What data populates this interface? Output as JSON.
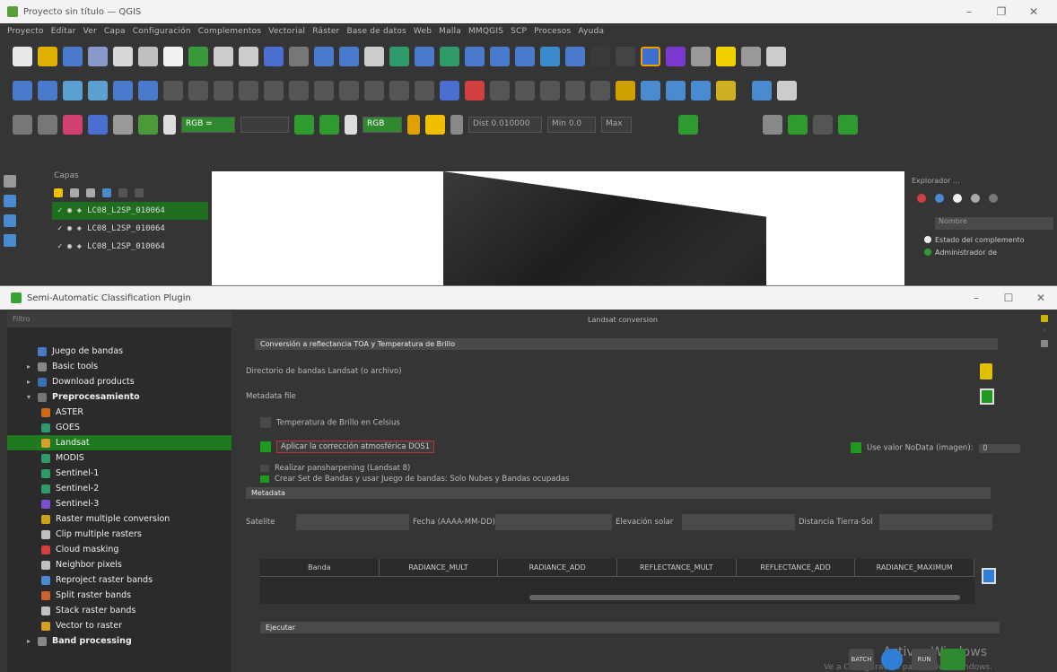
{
  "qgis": {
    "title": "Proyecto sin título — QGIS",
    "menu": [
      "Proyecto",
      "Editar",
      "Ver",
      "Capa",
      "Configuración",
      "Complementos",
      "Vectorial",
      "Ráster",
      "Base de datos",
      "Web",
      "Malla",
      "MMQGIS",
      "SCP",
      "Procesos",
      "Ayuda"
    ],
    "toolbar3": {
      "rgb_label": "RGB =",
      "rgb2_label": "RGB",
      "dist_label": "Dist 0.010000",
      "min_label": "Min 0.0",
      "max_label": "Max"
    },
    "layers_title": "Capas",
    "layers": [
      "LC08_L2SP_010064",
      "LC08_L2SP_010064",
      "LC08_L2SP_010064"
    ],
    "browser_title": "Explorador ... ",
    "browser_bar": "Nombre",
    "browser_rows": [
      "Estado del complemento",
      "Administrador de"
    ]
  },
  "scp": {
    "title": "Semi-Automatic Classification Plugin",
    "search_placeholder": "Filtro",
    "menu": [
      {
        "label": "Juego de bandas",
        "level": 1,
        "icon": "band-set-icon",
        "color": "#4a7acc"
      },
      {
        "label": "Basic tools",
        "level": 1,
        "icon": "tools-icon",
        "color": "#888888",
        "arrow": "▸"
      },
      {
        "label": "Download products",
        "level": 1,
        "icon": "download-icon",
        "color": "#3a6fb0",
        "arrow": "▸"
      },
      {
        "label": "Preprocesamiento",
        "level": 1,
        "icon": "preprocessing-icon",
        "color": "#777777",
        "arrow": "▾",
        "bold": true
      },
      {
        "label": "ASTER",
        "level": 2,
        "icon": "aster-icon",
        "color": "#d06a1a"
      },
      {
        "label": "GOES",
        "level": 2,
        "icon": "goes-icon",
        "color": "#2f9a6a"
      },
      {
        "label": "Landsat",
        "level": 2,
        "icon": "landsat-icon",
        "color": "#d8a02a",
        "selected": true
      },
      {
        "label": "MODIS",
        "level": 2,
        "icon": "modis-icon",
        "color": "#2f9a6a"
      },
      {
        "label": "Sentinel-1",
        "level": 2,
        "icon": "sentinel1-icon",
        "color": "#2f9a6a"
      },
      {
        "label": "Sentinel-2",
        "level": 2,
        "icon": "sentinel2-icon",
        "color": "#2f9a6a"
      },
      {
        "label": "Sentinel-3",
        "level": 2,
        "icon": "sentinel3-icon",
        "color": "#7a4fd0"
      },
      {
        "label": "Raster multiple conversion",
        "level": 2,
        "icon": "conversion-icon",
        "color": "#d0a020"
      },
      {
        "label": "Clip multiple rasters",
        "level": 2,
        "icon": "clip-icon",
        "color": "#c0c0c0"
      },
      {
        "label": "Cloud masking",
        "level": 2,
        "icon": "cloud-mask-icon",
        "color": "#d04040"
      },
      {
        "label": "Neighbor pixels",
        "level": 2,
        "icon": "neighbor-icon",
        "color": "#c0c0c0"
      },
      {
        "label": "Reproject raster bands",
        "level": 2,
        "icon": "reproject-icon",
        "color": "#4a8ad0"
      },
      {
        "label": "Split raster bands",
        "level": 2,
        "icon": "split-icon",
        "color": "#d06030"
      },
      {
        "label": "Stack raster bands",
        "level": 2,
        "icon": "stack-icon",
        "color": "#c0c0c0"
      },
      {
        "label": "Vector to raster",
        "level": 2,
        "icon": "vector-raster-icon",
        "color": "#d0a020"
      },
      {
        "label": "Band processing",
        "level": 1,
        "icon": "band-processing-icon",
        "color": "#888888",
        "arrow": "▸",
        "bold": true
      }
    ],
    "tab_label": "Landsat conversion",
    "section_conversion": "Conversión a reflectancia TOA y Temperatura de Brillo",
    "dir_label": "Directorio de bandas Landsat (o archivo)",
    "metadata_label": "Metadata file",
    "brightness_label": "Temperatura de Brillo en Celsius",
    "dos_label": "Aplicar la corrección atmosférica DOS1",
    "nodata_label": "Use valor NoData (imagen):",
    "nodata_value": "0",
    "pansharp_label": "Realizar pansharpening (Landsat 8)",
    "create_label": "Crear Set de Bandas y usar Juego de bandas: Solo Nubes y Bandas ocupadas",
    "metadata_section": "Metadata",
    "sat_label": "Satelite",
    "date_label": "Fecha (AAAA-MM-DD)",
    "sun_elev_label": "Elevación solar",
    "earth_sun_label": "Distancia Tierra-Sol",
    "columns": [
      "Banda",
      "RADIANCE_MULT",
      "RADIANCE_ADD",
      "REFLECTANCE_MULT",
      "REFLECTANCE_ADD",
      "RADIANCE_MAXIMUM"
    ],
    "run_section": "Ejecutar",
    "activate_title": "Activar Windows",
    "activate_sub": "Ve a Configuración para activar Windows.",
    "btn_batch": "BATCH",
    "btn_run": "RUN"
  },
  "colors": {
    "accent_green": "#1f7a1f",
    "folder_yellow": "#e0c000",
    "blue": "#2f7fd6"
  }
}
